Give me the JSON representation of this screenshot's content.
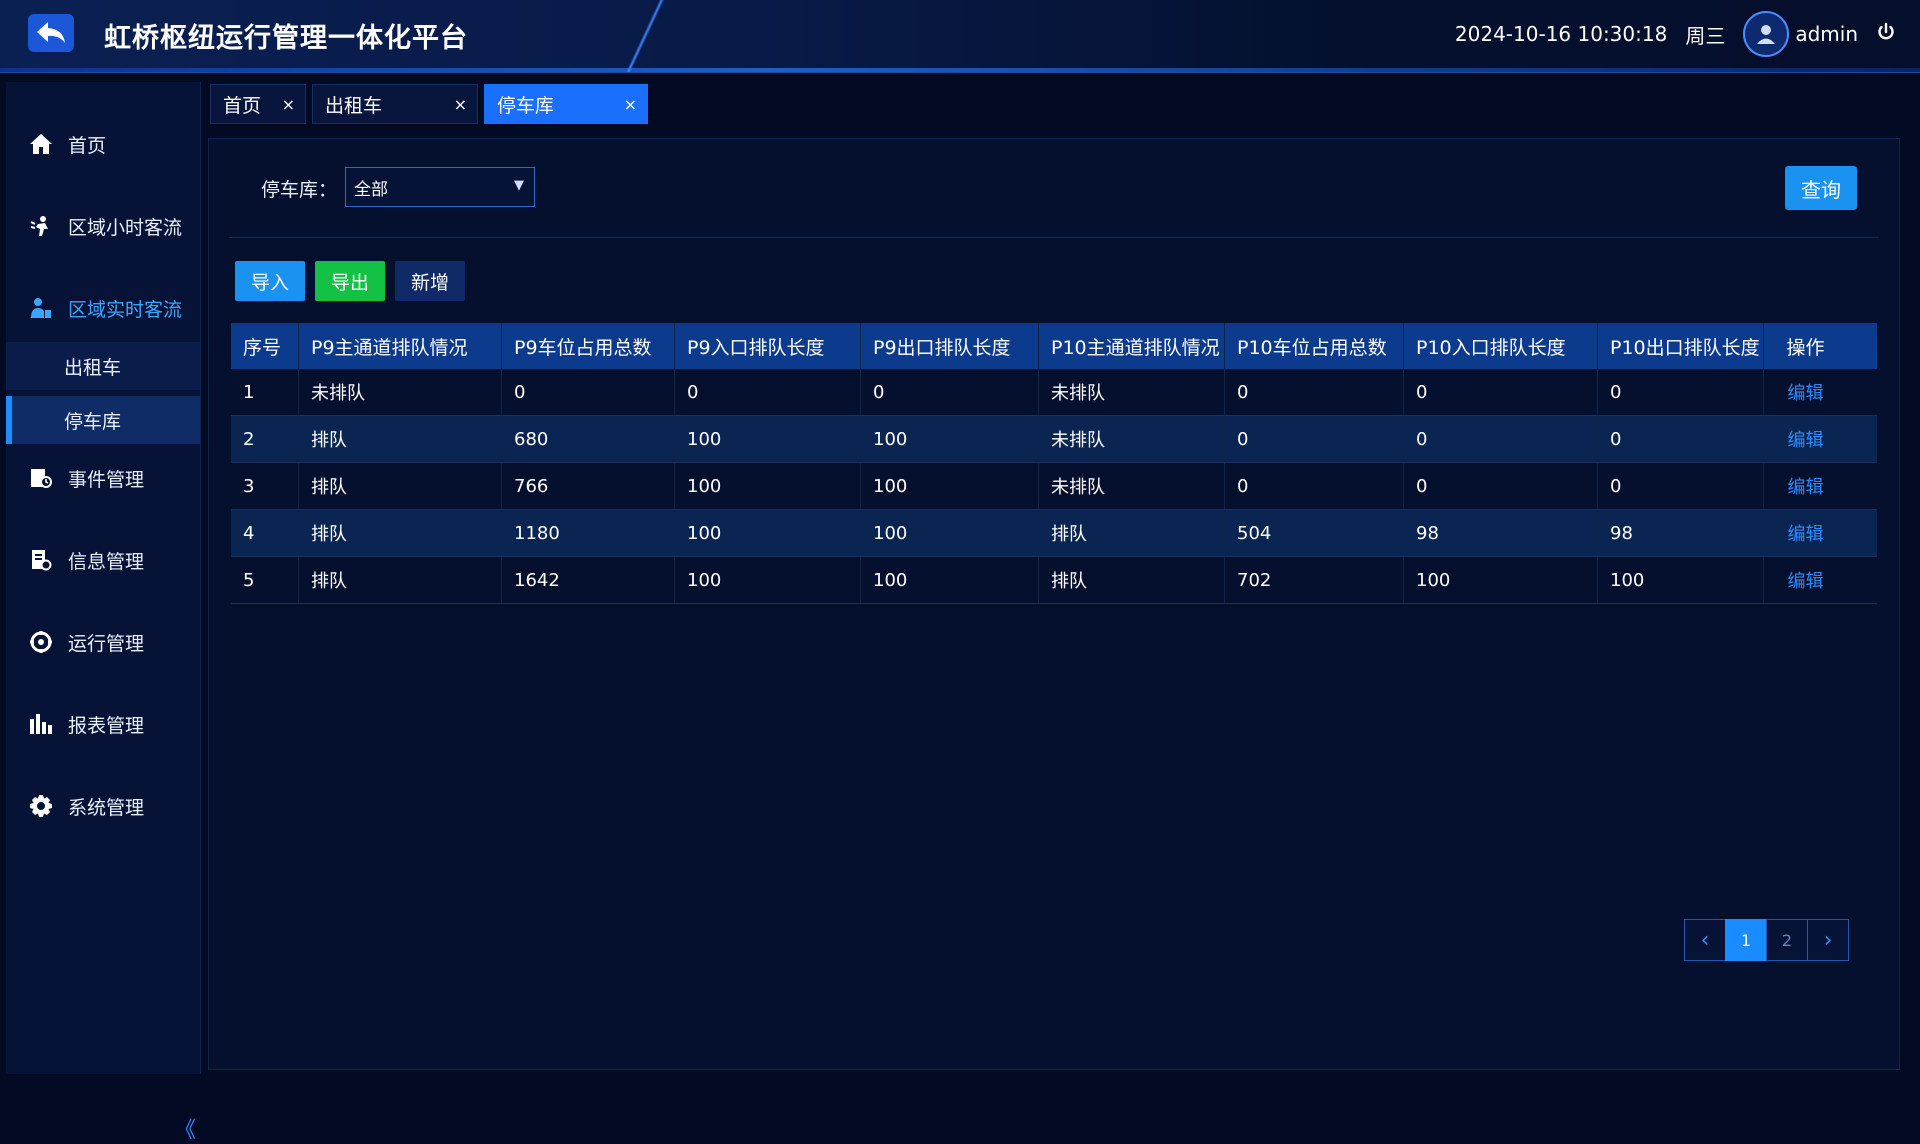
{
  "header": {
    "title": "虹桥枢纽运行管理一体化平台",
    "datetime": "2024-10-16 10:30:18",
    "weekday": "周三",
    "user": "admin"
  },
  "sidebar": {
    "items": [
      {
        "label": "首页",
        "icon": "home-icon"
      },
      {
        "label": "区域小时客流",
        "icon": "people-flow-icon"
      },
      {
        "label": "区域实时客流",
        "icon": "realtime-flow-icon"
      },
      {
        "label": "事件管理",
        "icon": "event-icon"
      },
      {
        "label": "信息管理",
        "icon": "info-icon"
      },
      {
        "label": "运行管理",
        "icon": "operation-icon"
      },
      {
        "label": "报表管理",
        "icon": "report-icon"
      },
      {
        "label": "系统管理",
        "icon": "settings-icon"
      }
    ],
    "sub_items": [
      {
        "label": "出租车"
      },
      {
        "label": "停车库"
      }
    ],
    "collapse": "《"
  },
  "tabs": [
    {
      "label": "首页",
      "close": "×"
    },
    {
      "label": "出租车",
      "close": "×"
    },
    {
      "label": "停车库",
      "close": "×"
    }
  ],
  "filter": {
    "label": "停车库：",
    "value": "全部",
    "query_label": "查询"
  },
  "actions": {
    "import": "导入",
    "export": "导出",
    "add": "新增"
  },
  "table": {
    "headers": [
      "序号",
      "P9主通道排队情况",
      "P9车位占用总数",
      "P9入口排队长度",
      "P9出口排队长度",
      "P10主通道排队情况",
      "P10车位占用总数",
      "P10入口排队长度",
      "P10出口排队长度",
      "操作"
    ],
    "rows": [
      [
        "1",
        "未排队",
        "0",
        "0",
        "0",
        "未排队",
        "0",
        "0",
        "0",
        "编辑"
      ],
      [
        "2",
        "排队",
        "680",
        "100",
        "100",
        "未排队",
        "0",
        "0",
        "0",
        "编辑"
      ],
      [
        "3",
        "排队",
        "766",
        "100",
        "100",
        "未排队",
        "0",
        "0",
        "0",
        "编辑"
      ],
      [
        "4",
        "排队",
        "1180",
        "100",
        "100",
        "排队",
        "504",
        "98",
        "98",
        "编辑"
      ],
      [
        "5",
        "排队",
        "1642",
        "100",
        "100",
        "排队",
        "702",
        "100",
        "100",
        "编辑"
      ]
    ]
  },
  "pagination": {
    "prev": "‹",
    "pages": [
      "1",
      "2"
    ],
    "next": "›",
    "current": "1"
  },
  "colors": {
    "accent": "#1a8cff",
    "export": "#13c244",
    "background": "#030b24"
  }
}
